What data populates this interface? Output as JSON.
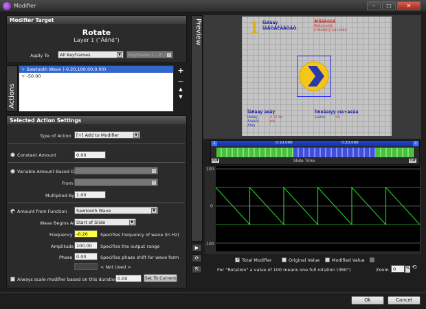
{
  "window": {
    "title": "Modifier",
    "minimize": "–",
    "maximize": "□",
    "close": "✕"
  },
  "modifier_target": {
    "header": "Modifier Target",
    "title": "Rotate",
    "subtitle": "Layer 1 (\"Äêñé\")",
    "apply_to_label": "Apply To",
    "apply_to_value": "All Keyframes",
    "keyframe_value": "Keyframe 1 - 2"
  },
  "actions": {
    "tab_label": "Actions",
    "items": [
      "+ Sawtooth Wave (-0.20,100.00,0.00)",
      "+ -50.00"
    ],
    "add": "+",
    "remove": "−",
    "up": "▲",
    "down": "▼"
  },
  "selected": {
    "header": "Selected Action Settings",
    "type_label": "Type of Action",
    "type_value": "[+] Add to Modifier",
    "constant_label": "Constant Amount",
    "constant_value": "0.00",
    "variable_label": "Variable Amount Based On",
    "variable_value": "",
    "from_label": "From",
    "from_value": "",
    "multiplied_label": "Multiplied By",
    "multiplied_value": "1.00",
    "function_label": "Amount from Function",
    "function_value": "Sawtooth Wave",
    "wave_begins_label": "Wave Begins At",
    "wave_begins_value": "Start of Slide",
    "frequency_label": "Frequency",
    "frequency_value": "-0.20",
    "frequency_help": "Specifies frequency of wave (in Hz)",
    "amplitude_label": "Amplitude",
    "amplitude_value": "100.00",
    "amplitude_help": "Specifies the output range",
    "phase_label": "Phase",
    "phase_value": "0.00",
    "phase_help": "Specifies phase shift for wave form",
    "not_used": "< Not Used >",
    "always_scale_label": "Always scale modifier based on this duration.",
    "always_scale_value": "0.00",
    "set_to_current": "Set To Current"
  },
  "preview": {
    "tab_label": "Preview",
    "big_number": "1",
    "text_tl1": "Ïåðâàÿ",
    "text_tl2": "ÏÂÅÒÅÊÂÅÒÂÒ.",
    "text_tr1": "Äîáàâüòå",
    "text_tr2": "Ïåðâàÿ àëåÿ",
    "text_tr3": "å Ïîñëåäíÿÿ çïà+àëåà",
    "text_bl1": "Ïåðâàÿ àëåÿ",
    "text_bl2": "Ïåðâàÿ",
    "text_bl2v": "-2.37 Ab",
    "text_bl3": "Ãëàâíîå",
    "text_bl3v": "100",
    "text_bl4": "Äåëà",
    "text_br1": "Ïîñëåäíÿÿ çïà+àëåà",
    "text_br2": "Çàïèñü",
    "text_br2v": "3%",
    "accent": "#f5c518",
    "icon": "chevron-right-icon"
  },
  "timeline": {
    "t0": "0:10,000",
    "t1": "0:20,000",
    "marker_start": "1",
    "marker_end": "2",
    "cut_left": "cut",
    "cut_right": "cut",
    "slide_time": "Slide Time"
  },
  "graph": {
    "y_max": "100",
    "y_zero": "0",
    "y_min": "-100",
    "legend_total": "Total Modifier",
    "legend_original": "Original Value",
    "legend_modified": "Modified Value",
    "legend_other": "",
    "info": "For \"Rotation\" a value of 100 means one full rotation (360°)",
    "zoom_label": "Zoom",
    "zoom_value": "0",
    "zoom_unit": "%"
  },
  "side_tools": {
    "play": "▶",
    "tool1": "⟳",
    "tool2": "⇱"
  },
  "footer": {
    "ok": "Ok",
    "cancel": "Cancel"
  }
}
